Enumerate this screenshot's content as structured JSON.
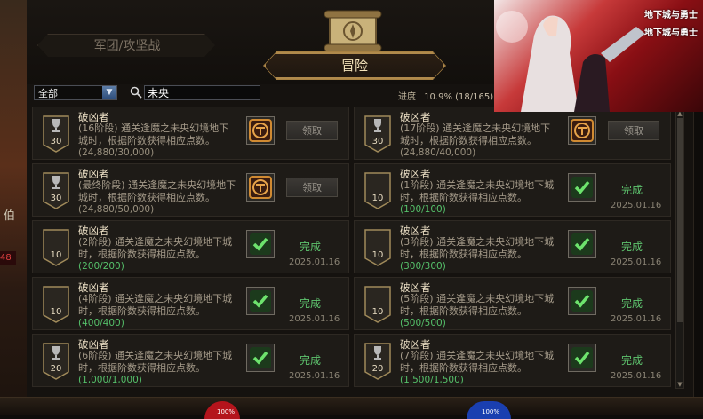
{
  "scene": {
    "left_number": "48",
    "left_glyph": "伯"
  },
  "tabs": {
    "legion": "军团/攻坚战",
    "adventure": "冒险"
  },
  "filter": {
    "selected": "全部"
  },
  "search": {
    "value": "未央"
  },
  "progress": {
    "label": "进度",
    "value": "10.9% (18/165)"
  },
  "claim_label": "领取",
  "done_label": "完成",
  "achievements": [
    {
      "title": "破凶者",
      "desc": "(16阶段) 通关逢魔之未央幻境地下城时，根据阶数获得相应点数。",
      "count": "(24,880/30,000)",
      "points": "30",
      "trophy": true,
      "state": "claim",
      "date": ""
    },
    {
      "title": "破凶者",
      "desc": "(17阶段) 通关逢魔之未央幻境地下城时，根据阶数获得相应点数。",
      "count": "(24,880/40,000)",
      "points": "30",
      "trophy": true,
      "state": "claim",
      "date": ""
    },
    {
      "title": "破凶者",
      "desc": "(最终阶段) 通关逢魔之未央幻境地下城时，根据阶数获得相应点数。",
      "count": "(24,880/50,000)",
      "points": "30",
      "trophy": true,
      "state": "claim",
      "date": ""
    },
    {
      "title": "破凶者",
      "desc": "(1阶段) 通关逢魔之未央幻境地下城时，根据阶数获得相应点数。",
      "count": "(100/100)",
      "points": "10",
      "trophy": false,
      "state": "done",
      "date": "2025.01.16"
    },
    {
      "title": "破凶者",
      "desc": "(2阶段) 通关逢魔之未央幻境地下城时，根据阶数获得相应点数。",
      "count": "(200/200)",
      "points": "10",
      "trophy": false,
      "state": "done",
      "date": "2025.01.16"
    },
    {
      "title": "破凶者",
      "desc": "(3阶段) 通关逢魔之未央幻境地下城时，根据阶数获得相应点数。",
      "count": "(300/300)",
      "points": "10",
      "trophy": false,
      "state": "done",
      "date": "2025.01.16"
    },
    {
      "title": "破凶者",
      "desc": "(4阶段) 通关逢魔之未央幻境地下城时，根据阶数获得相应点数。",
      "count": "(400/400)",
      "points": "10",
      "trophy": false,
      "state": "done",
      "date": "2025.01.16"
    },
    {
      "title": "破凶者",
      "desc": "(5阶段) 通关逢魔之未央幻境地下城时，根据阶数获得相应点数。",
      "count": "(500/500)",
      "points": "10",
      "trophy": false,
      "state": "done",
      "date": "2025.01.16"
    },
    {
      "title": "破凶者",
      "desc": "(6阶段) 通关逢魔之未央幻境地下城时，根据阶数获得相应点数。",
      "count": "(1,000/1,000)",
      "points": "20",
      "trophy": true,
      "state": "done",
      "date": "2025.01.16"
    },
    {
      "title": "破凶者",
      "desc": "(7阶段) 通关逢魔之未央幻境地下城时，根据阶数获得相应点数。",
      "count": "(1,500/1,500)",
      "points": "20",
      "trophy": true,
      "state": "done",
      "date": "2025.01.16"
    }
  ],
  "promo": {
    "logo": "地下城与勇士"
  },
  "hud": {
    "hp": "100%",
    "mp": "100%"
  },
  "colors": {
    "accent": "#a78142",
    "done": "#5ec46e",
    "panel": "#15120f"
  }
}
